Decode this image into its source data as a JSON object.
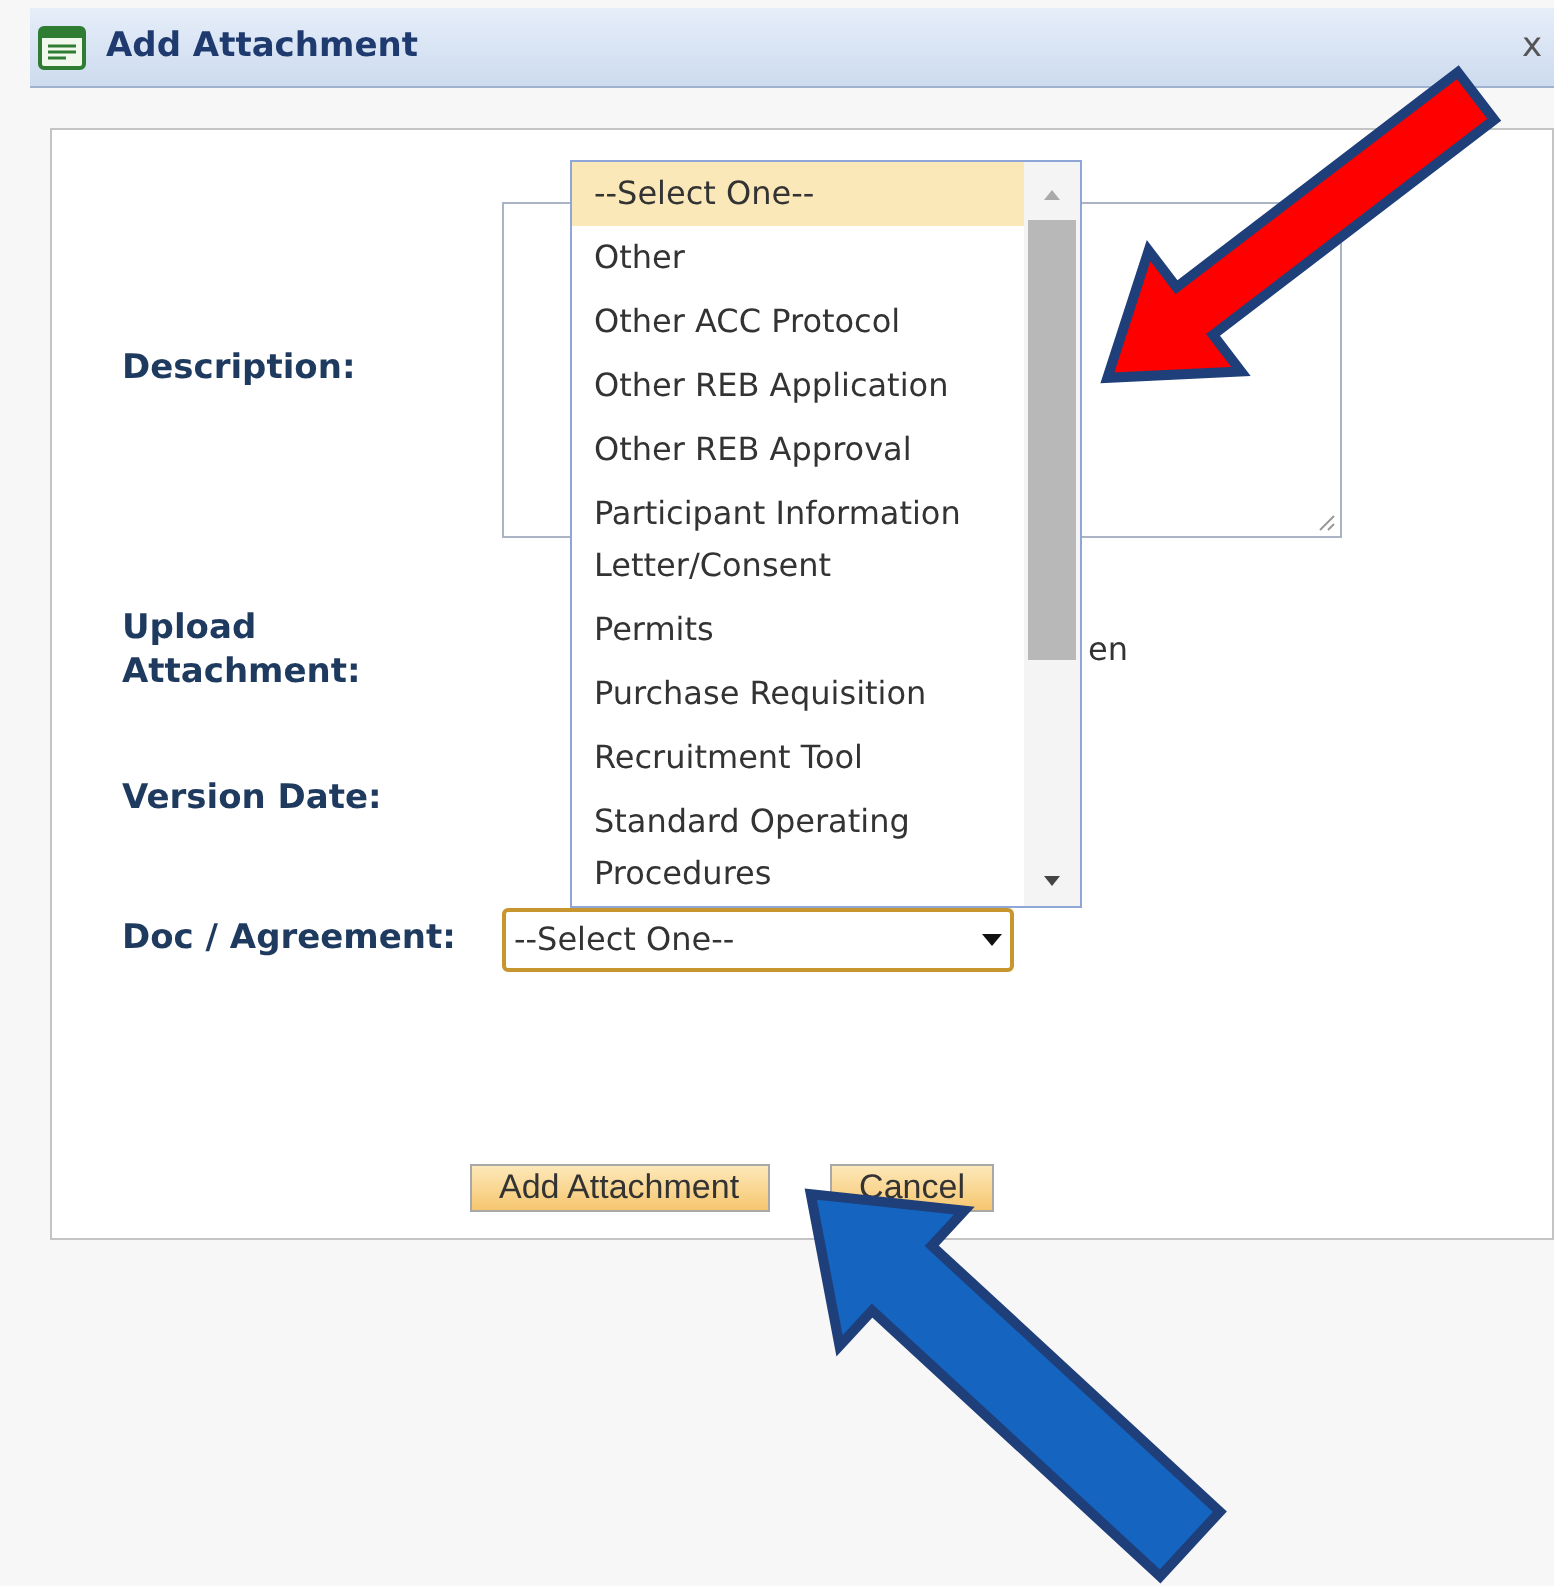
{
  "window": {
    "title": "Add Attachment",
    "close": "x"
  },
  "form": {
    "fields": [
      {
        "kind": "textarea",
        "label": "Description:"
      },
      {
        "kind": "upload",
        "label": "Upload Attachment:",
        "value": "en"
      },
      {
        "kind": "date",
        "label": "Version Date:"
      },
      {
        "kind": "select",
        "label": "Doc / Agreement:",
        "value": "--Select One--"
      }
    ]
  },
  "dropdown": {
    "options": [
      {
        "label": "--Select One--",
        "selected": true
      },
      {
        "label": "Other",
        "selected": false
      },
      {
        "label": "Other ACC Protocol",
        "selected": false
      },
      {
        "label": "Other REB Application",
        "selected": false
      },
      {
        "label": "Other REB Approval",
        "selected": false
      },
      {
        "label": "Participant Information Letter/Consent",
        "selected": false
      },
      {
        "label": "Permits",
        "selected": false
      },
      {
        "label": "Purchase Requisition",
        "selected": false
      },
      {
        "label": "Recruitment Tool",
        "selected": false
      },
      {
        "label": "Standard Operating Procedures",
        "selected": false
      }
    ]
  },
  "buttons": [
    "Add Attachment",
    "Cancel"
  ],
  "annotations": [
    {
      "kind": "arrow",
      "color": "#ff0000"
    },
    {
      "kind": "arrow",
      "color": "#1565c0"
    }
  ]
}
